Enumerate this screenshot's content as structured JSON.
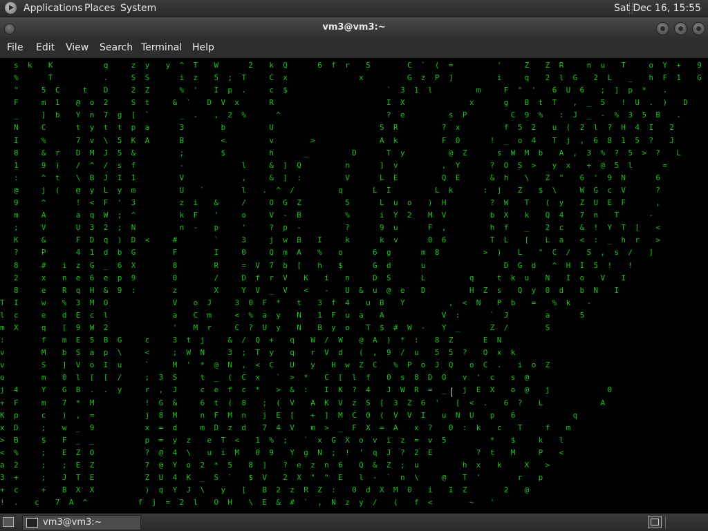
{
  "top_panel": {
    "applications": "Applications",
    "places": "Places",
    "system": "System",
    "clock": "Sat Dec 16, 15:55"
  },
  "window": {
    "title": "vm3@vm3:~"
  },
  "menubar": {
    "file": "File",
    "edit": "Edit",
    "view": "View",
    "search": "Search",
    "terminal": "Terminal",
    "help": "Help"
  },
  "terminal": {
    "text_color": "#1ec21e",
    "lines": [
      "  s k  K       q   z y  y ^ T  W    2  k Q    6 f r  S     C ` ( =      '   Z  Z R   n u  T   o Y +  9",
      "  %    T       .   S S    i z  5 ; T   C x          x      G z P ]      i   q  2 l G  2 L  _  h F 1  G",
      "  \"   5 C   t  D   2 Z    % '  I p .   c $              ` 3 1 l      m   F \" '  6 U 6  ; ] p *  .",
      "  F   m 1  @ o 2   S t   & `  D V x    R                I X         x    g  B t T  , _ 5  ! U . )  D",
      "  _   ] b  Y n 7 g [ `    _ .  , 2 %    ^               ? e      s P      C 9 %  : J _ - % 3 5 B  .",
      "  N   C    t y t t p a    3     b      U               S R      ? x      f 5 2  u ( 2 l ? H 4 I  2",
      "  I   %    7 v \\ 5 K A    B     <      v     >         A k      F 0    ! _ o 4  T j , 6 8 1 5 ?  J",
      "  8   & r  D M J 5 &      ;     $      h    _      D    T y      @ Z    s W M b  A , 3 % ? 5 > ?  L",
      "  1   9 )  / ^ / s f      -        l   & ] Q      n    ] v      , Y    ? O S >  y x  + @ 5 l    =",
      "  :   ^ t  \\ B J I 1      V        ,   & ] :      V    L E      Q E    & h  \\  Z \"  6 ' 9 N    6",
      "  @   j (  @ y L y m      U  `     l  . ^ /      q    L I      L k    : j  Z  $ \\   W G c V    ?",
      "  9   ^    ! < F ' 3      z i  &   /   O G Z      5    L u o  ) H      ? W  T  ( y  Z U E F    ,",
      "  m   A    a q W ; ^      k F  '   o   V - B      %    i Y 2  M V      b X  k  Q 4  7 n  T    -",
      "  ;   V    U 3 2 ; N      n -  p   '   ? p -      ?    9 u    F ,      h f  _  2 c  & ! Y T [  <",
      "  K   &    F D q ) D <   #     `   3   j w B  I   k    k v    0 6      T L  [  L a  < : _ h r  >",
      "  ?   P    4 1 d b G     F     I   0   Q m A  %  o    6 g    m 8      > )  L  \" C /  S , s /  ]",
      "  8   #  i z G _ 6 X     8     R   = V 7 b [  h  $    G d    u           D G d  ^ H I 5 !  !",
      "  2   x  n e 6 e p 9     0     /   D f r V  K  i  n   D S    L      q   t k u  N  I o  V  I",
      "  8   e  R q H & 9 :     z     X   Y V _ V  <  -  U & u @ e  D      H Z s  Q y 0 d  b N  I",
      "T I   w  % 3 M O         V  o J   3 0 F *  t  3 f 4  u B  Y      , < N  P b  =  % k  -",
      "l c   e  d E c l         a  C m   < % a y  N  1 F u a  A        V :    ` J     a    5",
      "m X   q  [ 9 W 2         '  M r   C ? U y  N  B y o  T $ # W -  Y _    Z /     S",
      ":     f  m E 5 B G   c   3 t j   & / Q +  q  W / W  @ A ) * :  8 Z    E N",
      "v     M  b S a p \\   <   ; W N   3 ; T y  q  r V d  ( , 9 / u  5 5 ?  O x k",
      "v     S  ] V o I u   `   M ' * @ N , < C  U  y  H w Z C  % P o J Q  o C .  i o Z",
      "o     m  0 l [ [ /   ; 3 S   t _ ( C x  ` > *  C [ l f  0 s 8 D O  v ' c  s @",
      "j 4   Y  G B . . y   r , J   c e f c *  > & :  I K ? 4  J W R = _  j E X  o @  j        0",
      "+ F   m  7 * M       ! G &   6 t ( 8  ; ( V  A K V z S [ 3 Z 6 '  [ < .  6 ?  L        A",
      "K p   c  ) , =       j 8 M   n F M n  j E [  + ] M C 0 ( V V I  u N U  p  6        q",
      "x D   ;  w _ 9       x = d   m D z d  7 4 V  m > _ F X = A  x ?  0 : k  c  T   f  m",
      "> B   $  F _ _       p = y z  e T <  1 % ;  ` x G X o v i z = v 5      *  $   k  l",
      "< %   ;  E Z O       ? @ 4 \\  u i M  0 9  Y g N ; ! ' q J ? 2 E      ? t  M   P  <",
      "a 2   ;  ; E Z       7 @ Y o 2 * 5  8 ]  ? e z n 6  Q & Z ; u      h x  k   X  >",
      "3 +   ;  J T E       Z U 4 K _ S `  $ V  2 X \" \" E  l - ` n \\   @  T '     r  p",
      "+ c   +  B X X       ) q Y J \\  y  [  B 2 z R Z :  0 d X M 0  i  I Z     2  @",
      "! .  c  7 A ^       f j = 2 l  O H  \\ E & # ` , N z y /  (  f <     ~  '"
    ]
  },
  "taskbar": {
    "item_label": "vm3@vm3:~"
  }
}
